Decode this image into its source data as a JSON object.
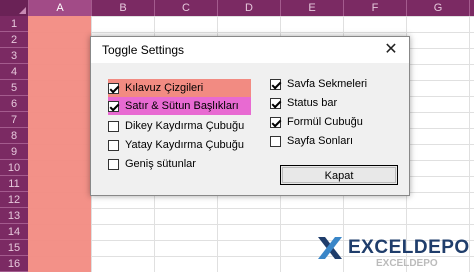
{
  "sheet": {
    "columns": [
      "A",
      "B",
      "C",
      "D",
      "E",
      "F",
      "G"
    ],
    "rows": [
      "1",
      "2",
      "3",
      "4",
      "5",
      "6",
      "7",
      "8",
      "9",
      "10",
      "11",
      "12",
      "13",
      "14",
      "15",
      "16"
    ]
  },
  "dialog": {
    "title": "Toggle Settings",
    "close_glyph": "✕",
    "left_options": [
      {
        "label": "Kılavuz Çizgileri",
        "checked": true
      },
      {
        "label": "Satır & Sütun Başlıkları",
        "checked": true
      },
      {
        "label": "Dikey Kaydırma Çubuğu",
        "checked": false
      },
      {
        "label": "Yatay Kaydırma Çubuğu",
        "checked": false
      },
      {
        "label": "Geniş sütunlar",
        "checked": false
      }
    ],
    "right_options": [
      {
        "label": "Savfa Sekmeleri",
        "checked": true
      },
      {
        "label": "Status bar",
        "checked": true
      },
      {
        "label": "Formül Cubuğu",
        "checked": true
      },
      {
        "label": "Sayfa Sonları",
        "checked": false
      }
    ],
    "close_button": "Kapat",
    "highlight_colors": {
      "first": "#f28b82",
      "second": "#e86ad2"
    }
  },
  "logo": {
    "text": "EXCELDEPO",
    "watermark": "EXCELDEPO"
  }
}
